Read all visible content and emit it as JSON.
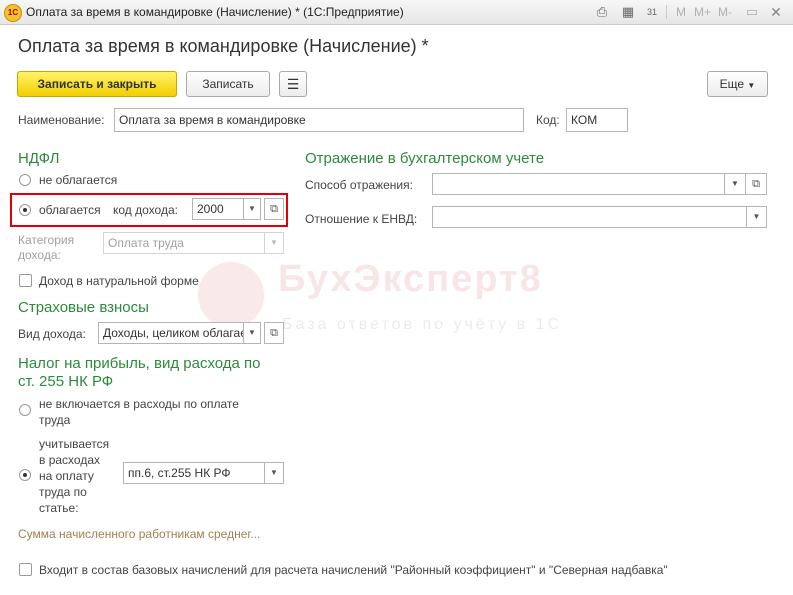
{
  "window": {
    "title": "Оплата за время в командировке (Начисление) * (1С:Предприятие)",
    "logo": "1С",
    "controls": {
      "m": "M",
      "m_plus": "M+",
      "m_minus": "M-",
      "calendar_day": "31"
    }
  },
  "form": {
    "title": "Оплата за время в командировке (Начисление) *",
    "toolbar": {
      "save_close": "Записать и закрыть",
      "save": "Записать",
      "more": "Еще"
    },
    "name_label": "Наименование:",
    "name_value": "Оплата за время в командировке",
    "code_label": "Код:",
    "code_value": "КОМ"
  },
  "ndfl": {
    "title": "НДФЛ",
    "not_taxed": "не облагается",
    "taxed": "облагается",
    "income_code_label": "код дохода:",
    "income_code_value": "2000",
    "category_label_1": "Категория",
    "category_label_2": "дохода:",
    "category_value": "Оплата труда",
    "in_kind_label": "Доход в натуральной форме"
  },
  "insurance": {
    "title": "Страховые взносы",
    "income_type_label": "Вид дохода:",
    "income_type_value": "Доходы, целиком облагаемые"
  },
  "profit_tax": {
    "title_1": "Налог на прибыль, вид расхода по",
    "title_2": "ст. 255 НК РФ",
    "not_included_1": "не включается в расходы по оплате",
    "not_included_2": "труда",
    "included_lines": [
      "учитывается",
      "в расходах",
      "на оплату",
      "труда по",
      "статье:"
    ],
    "article_value": "пп.6, ст.255 НК РФ",
    "avg_link": "Сумма начисленного работникам среднег..."
  },
  "accounting": {
    "title": "Отражение в бухгалтерском учете",
    "method_label": "Способ отражения:",
    "method_value": "",
    "envd_label": "Отношение к ЕНВД:",
    "envd_value": ""
  },
  "base_accruals_label": "Входит в состав базовых начислений для расчета начислений \"Районный коэффициент\" и \"Северная надбавка\"",
  "watermark": {
    "main": "БухЭксперт8",
    "sub": "База ответов по учёту в 1С"
  }
}
